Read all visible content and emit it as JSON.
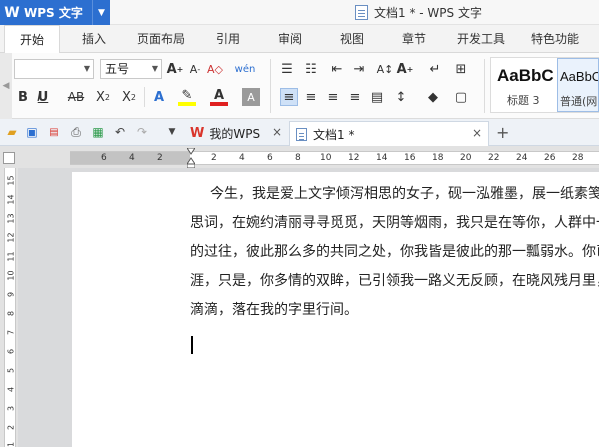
{
  "app": {
    "name": "WPS 文字",
    "window_title": "文档1 * - WPS 文字"
  },
  "menu": {
    "tabs": [
      "开始",
      "插入",
      "页面布局",
      "引用",
      "审阅",
      "视图",
      "章节",
      "开发工具",
      "特色功能"
    ],
    "active": "开始"
  },
  "ribbon": {
    "font_name": "",
    "font_size": "五号",
    "styles": [
      {
        "sample": "AaBbC",
        "label": "标题 3"
      },
      {
        "sample": "AaBbC",
        "label": "普通(网"
      }
    ]
  },
  "doc_tabs": [
    {
      "label": "我的WPS",
      "active": false
    },
    {
      "label": "文档1 *",
      "active": true
    }
  ],
  "ruler": {
    "h_numbers": [
      "6",
      "4",
      "2",
      "2",
      "4",
      "6",
      "8",
      "10",
      "12",
      "14",
      "16",
      "18",
      "20",
      "22",
      "24",
      "26",
      "28"
    ],
    "v_numbers": [
      "15",
      "14",
      "13",
      "12",
      "11",
      "10",
      "9",
      "8",
      "7",
      "6",
      "5",
      "4",
      "3",
      "2",
      "1"
    ]
  },
  "document": {
    "lines": [
      "今生，我是爱上文字倾泻相思的女子，砚一泓雅墨，展一纸素笺",
      "思词，在婉约清丽寻寻觅觅，天阴等烟雨，我只是在等你，人群中一",
      "的过往，彼此那么多的共同之处，你我皆是彼此的那一瓢弱水。你已",
      "涯，只是，你多情的双眸，已引领我一路义无反顾，在晓风残月里，",
      "滴滴，落在我的字里行间。"
    ]
  },
  "colors": {
    "accent": "#2c6fd0",
    "canvas": "#d9dadc",
    "highlight": "#ffff00",
    "font_color": "#e02020",
    "wps_red": "#d9342b"
  }
}
